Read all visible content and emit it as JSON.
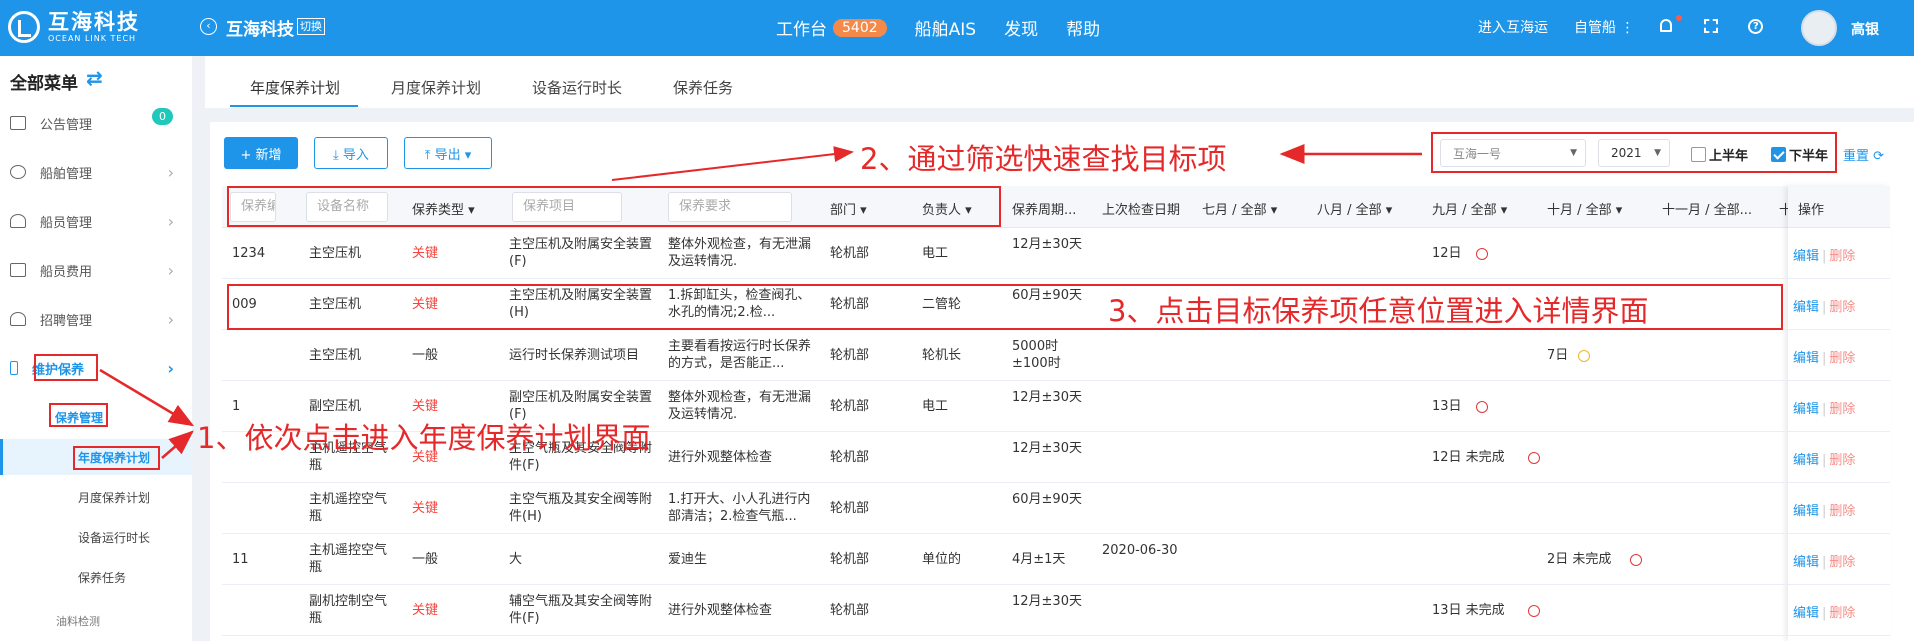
{
  "topbar": {
    "logo_cn": "互海科技",
    "logo_en": "OCEAN LINK TECH",
    "company": "互海科技",
    "switch": "切换",
    "nav": [
      {
        "label": "工作台",
        "badge": "5402"
      },
      {
        "label": "船舶AIS"
      },
      {
        "label": "发现"
      },
      {
        "label": "帮助"
      }
    ],
    "enter": "进入互海运",
    "self_ship": "自管船 ⋮",
    "help_glyph": "?",
    "user": "高银"
  },
  "sidebar": {
    "title": "全部菜单",
    "swap": "⇄",
    "items": [
      {
        "label": "公告管理",
        "badge": "0"
      },
      {
        "label": "船舶管理"
      },
      {
        "label": "船员管理"
      },
      {
        "label": "船员费用"
      },
      {
        "label": "招聘管理"
      },
      {
        "label": "维护保养"
      }
    ],
    "maint_sub": "保养管理",
    "subs": [
      "年度保养计划",
      "月度保养计划",
      "设备运行时长",
      "保养任务"
    ],
    "oil": "油料检测",
    "chevron": "›"
  },
  "tabs": [
    "年度保养计划",
    "月度保养计划",
    "设备运行时长",
    "保养任务"
  ],
  "toolbar": {
    "add": "+ 新增",
    "import": "⤓ 导入",
    "export": "⤒ 导出 ▾"
  },
  "filters": {
    "ship": "互海一号",
    "year": "2021",
    "first_half": "上半年",
    "second_half": "下半年",
    "reset": "重置 ⟳"
  },
  "table": {
    "inputs": [
      "保养编",
      "设备名称",
      "保养项目",
      "保养要求"
    ],
    "type_header": "保养类型 ▾",
    "headers": [
      "部门 ▾",
      "负责人 ▾",
      "保养周期...",
      "上次检查日期",
      "七月 / 全部 ▾",
      "八月 / 全部 ▾",
      "九月 / 全部 ▾",
      "十月 / 全部 ▾",
      "十一月 / 全部...",
      "十",
      "操作"
    ],
    "rows": [
      {
        "code": "1234",
        "device": "主空压机",
        "type": "关键",
        "item": "主空压机及附属安全装置(F)",
        "req": "整体外观检查，有无泄漏及运转情况.",
        "dept": "轮机部",
        "owner": "电工",
        "cycle": "12月±30天",
        "last": "",
        "sep": "12日",
        "oct": "",
        "ops": [
          "编辑",
          "删除"
        ]
      },
      {
        "code": "009",
        "device": "主空压机",
        "type": "关键",
        "item": "主空压机及附属安全装置(H)",
        "req": "1.拆卸缸头，检查阀孔、水孔的情况;2.检...",
        "dept": "轮机部",
        "owner": "二管轮",
        "cycle": "60月±90天",
        "last": "",
        "sep": "",
        "oct": "",
        "ops": [
          "编辑",
          "删除"
        ]
      },
      {
        "code": "",
        "device": "主空压机",
        "type": "一般",
        "item": "运行时长保养测试项目",
        "req": "主要看看按运行时长保养的方式，是否能正...",
        "dept": "轮机部",
        "owner": "轮机长",
        "cycle": "5000时 ±100时",
        "last": "",
        "sep": "",
        "oct": "7日",
        "ops": [
          "编辑",
          "删除"
        ]
      },
      {
        "code": "1",
        "device": "副空压机",
        "type": "关键",
        "item": "副空压机及附属安全装置(F)",
        "req": "整体外观检查，有无泄漏及运转情况.",
        "dept": "轮机部",
        "owner": "电工",
        "cycle": "12月±30天",
        "last": "",
        "sep": "13日",
        "oct": "",
        "ops": [
          "编辑",
          "删除"
        ]
      },
      {
        "code": "",
        "device": "主机遥控空气瓶",
        "type": "关键",
        "item": "主空气瓶及其安全阀等附件(F)",
        "req": "进行外观整体检查",
        "dept": "轮机部",
        "owner": "",
        "cycle": "12月±30天",
        "last": "",
        "sep": "12日 未完成",
        "oct": "",
        "ops": [
          "编辑",
          "删除"
        ]
      },
      {
        "code": "",
        "device": "主机遥控空气瓶",
        "type": "关键",
        "item": "主空气瓶及其安全阀等附件(H)",
        "req": "1.打开大、小人孔进行内部清洁；2.检查气瓶...",
        "dept": "轮机部",
        "owner": "",
        "cycle": "60月±90天",
        "last": "",
        "sep": "",
        "oct": "",
        "ops": [
          "编辑",
          "删除"
        ]
      },
      {
        "code": "11",
        "device": "主机遥控空气瓶",
        "type": "一般",
        "item": "大",
        "req": "爱迪生",
        "dept": "轮机部",
        "owner": "单位的",
        "cycle": "4月±1天",
        "last": "2020-06-30",
        "sep": "",
        "oct": "2日 未完成",
        "ops": [
          "编辑",
          "删除"
        ]
      },
      {
        "code": "",
        "device": "副机控制空气瓶",
        "type": "关键",
        "item": "辅空气瓶及其安全阀等附件(F)",
        "req": "进行外观整体检查",
        "dept": "轮机部",
        "owner": "",
        "cycle": "12月±30天",
        "last": "",
        "sep": "13日 未完成",
        "oct": "",
        "ops": [
          "编辑",
          "删除"
        ]
      }
    ]
  },
  "annotations": {
    "step1": "1、依次点击进入年度保养计划界面",
    "step2": "2、通过筛选快速查找目标项",
    "step3": "3、点击目标保养项任意位置进入详情界面",
    "color": "#e5292a"
  },
  "colors": {
    "primary": "#1e95e9",
    "critical": "#f5453d",
    "badge": "#f5894a"
  }
}
